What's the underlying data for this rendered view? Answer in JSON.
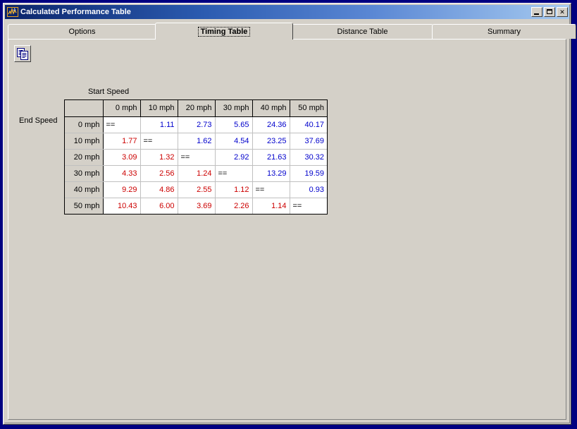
{
  "window": {
    "title": "Calculated Performance Table",
    "icon": "chart-waveform-icon",
    "minimize_label": "Minimize",
    "maximize_label": "Maximize",
    "close_label": "Close",
    "close_glyph": "✕"
  },
  "tabs": [
    {
      "label": "Options",
      "active": false
    },
    {
      "label": "Timing Table",
      "active": true
    },
    {
      "label": "Distance Table",
      "active": false
    },
    {
      "label": "Summary",
      "active": false
    }
  ],
  "toolbar": {
    "copy_button": {
      "name": "copy-button",
      "tooltip": "Copy"
    }
  },
  "table": {
    "column_axis_label": "Start Speed",
    "row_axis_label": "End Speed",
    "corner_label": "",
    "columns": [
      "0 mph",
      "10 mph",
      "20 mph",
      "30 mph",
      "40 mph",
      "50 mph"
    ],
    "rows": [
      "0 mph",
      "10 mph",
      "20 mph",
      "30 mph",
      "40 mph",
      "50 mph"
    ],
    "diagonal_marker": "==",
    "colors": {
      "acceleration": "#0000cc",
      "deceleration": "#cc0000",
      "identity": "#000000",
      "header_bg": "#d4d0c8",
      "cell_bg": "#ffffff",
      "grid_border": "#000000",
      "cell_border": "#c0c0c0"
    },
    "cells": [
      [
        {
          "text": "==",
          "kind": "identity"
        },
        {
          "text": "1.11",
          "kind": "acceleration"
        },
        {
          "text": "2.73",
          "kind": "acceleration"
        },
        {
          "text": "5.65",
          "kind": "acceleration"
        },
        {
          "text": "24.36",
          "kind": "acceleration"
        },
        {
          "text": "40.17",
          "kind": "acceleration"
        }
      ],
      [
        {
          "text": "1.77",
          "kind": "deceleration"
        },
        {
          "text": "==",
          "kind": "identity"
        },
        {
          "text": "1.62",
          "kind": "acceleration"
        },
        {
          "text": "4.54",
          "kind": "acceleration"
        },
        {
          "text": "23.25",
          "kind": "acceleration"
        },
        {
          "text": "37.69",
          "kind": "acceleration"
        }
      ],
      [
        {
          "text": "3.09",
          "kind": "deceleration"
        },
        {
          "text": "1.32",
          "kind": "deceleration"
        },
        {
          "text": "==",
          "kind": "identity"
        },
        {
          "text": "2.92",
          "kind": "acceleration"
        },
        {
          "text": "21.63",
          "kind": "acceleration"
        },
        {
          "text": "30.32",
          "kind": "acceleration"
        }
      ],
      [
        {
          "text": "4.33",
          "kind": "deceleration"
        },
        {
          "text": "2.56",
          "kind": "deceleration"
        },
        {
          "text": "1.24",
          "kind": "deceleration"
        },
        {
          "text": "==",
          "kind": "identity"
        },
        {
          "text": "13.29",
          "kind": "acceleration"
        },
        {
          "text": "19.59",
          "kind": "acceleration"
        }
      ],
      [
        {
          "text": "9.29",
          "kind": "deceleration"
        },
        {
          "text": "4.86",
          "kind": "deceleration"
        },
        {
          "text": "2.55",
          "kind": "deceleration"
        },
        {
          "text": "1.12",
          "kind": "deceleration"
        },
        {
          "text": "==",
          "kind": "identity"
        },
        {
          "text": "0.93",
          "kind": "acceleration"
        }
      ],
      [
        {
          "text": "10.43",
          "kind": "deceleration"
        },
        {
          "text": "6.00",
          "kind": "deceleration"
        },
        {
          "text": "3.69",
          "kind": "deceleration"
        },
        {
          "text": "2.26",
          "kind": "deceleration"
        },
        {
          "text": "1.14",
          "kind": "deceleration"
        },
        {
          "text": "==",
          "kind": "identity"
        }
      ]
    ]
  }
}
